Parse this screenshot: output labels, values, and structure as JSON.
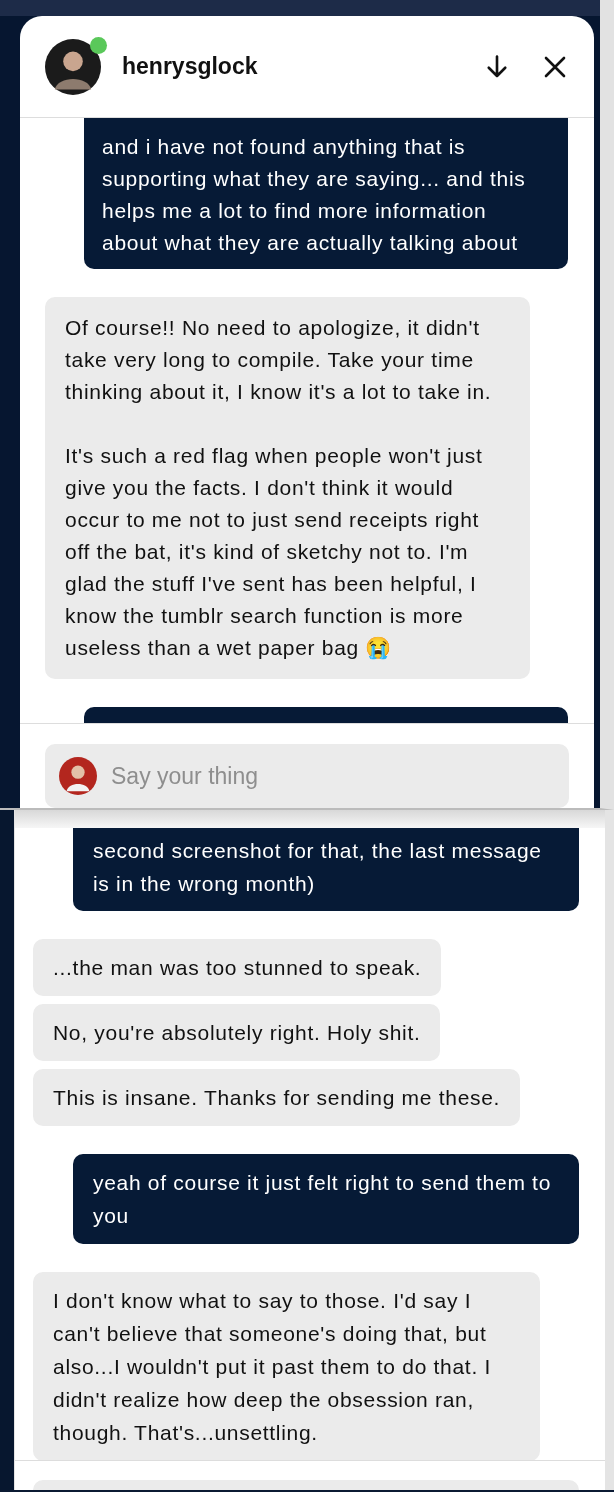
{
  "panels": [
    {
      "header": {
        "username": "henrysglock",
        "online": true
      },
      "messages": [
        {
          "kind": "me",
          "paragraphs": [
            "and i have not found anything that is supporting what they are saying... and this helps me a lot to find more information about what they are actually talking about"
          ]
        },
        {
          "kind": "them",
          "paragraphs": [
            "Of course!! No need to apologize, it didn't take very long to compile. Take your time thinking about it, I know it's a lot to take in.",
            "It's such a red flag when people won't just give you the facts. I don't think it would occur to me not to just send receipts right off the bat, it's kind of sketchy not to. I'm glad the stuff I've sent has been helpful, I know the tumblr search function is more useless than a wet paper bag 😭"
          ]
        },
        {
          "kind": "me"
        }
      ],
      "composer": {
        "placeholder": "Say your thing"
      }
    },
    {
      "messages": [
        {
          "kind": "me",
          "paragraphs": [
            "second screenshot for that, the last message is in the wrong month)"
          ]
        },
        {
          "kind": "them",
          "paragraphs": [
            "...the man was too stunned to speak."
          ]
        },
        {
          "kind": "them",
          "paragraphs": [
            "No, you're absolutely right. Holy shit."
          ]
        },
        {
          "kind": "them",
          "paragraphs": [
            "This is insane. Thanks for sending me these."
          ]
        },
        {
          "kind": "me",
          "paragraphs": [
            "yeah of course it just felt right to send them to you"
          ]
        },
        {
          "kind": "them",
          "paragraphs": [
            "I don't know what to say to those. I'd say I can't believe that someone's doing that, but also...I wouldn't put it past them to do that. I didn't realize how deep the obsession ran, though. That's...unsettling."
          ]
        }
      ]
    }
  ]
}
